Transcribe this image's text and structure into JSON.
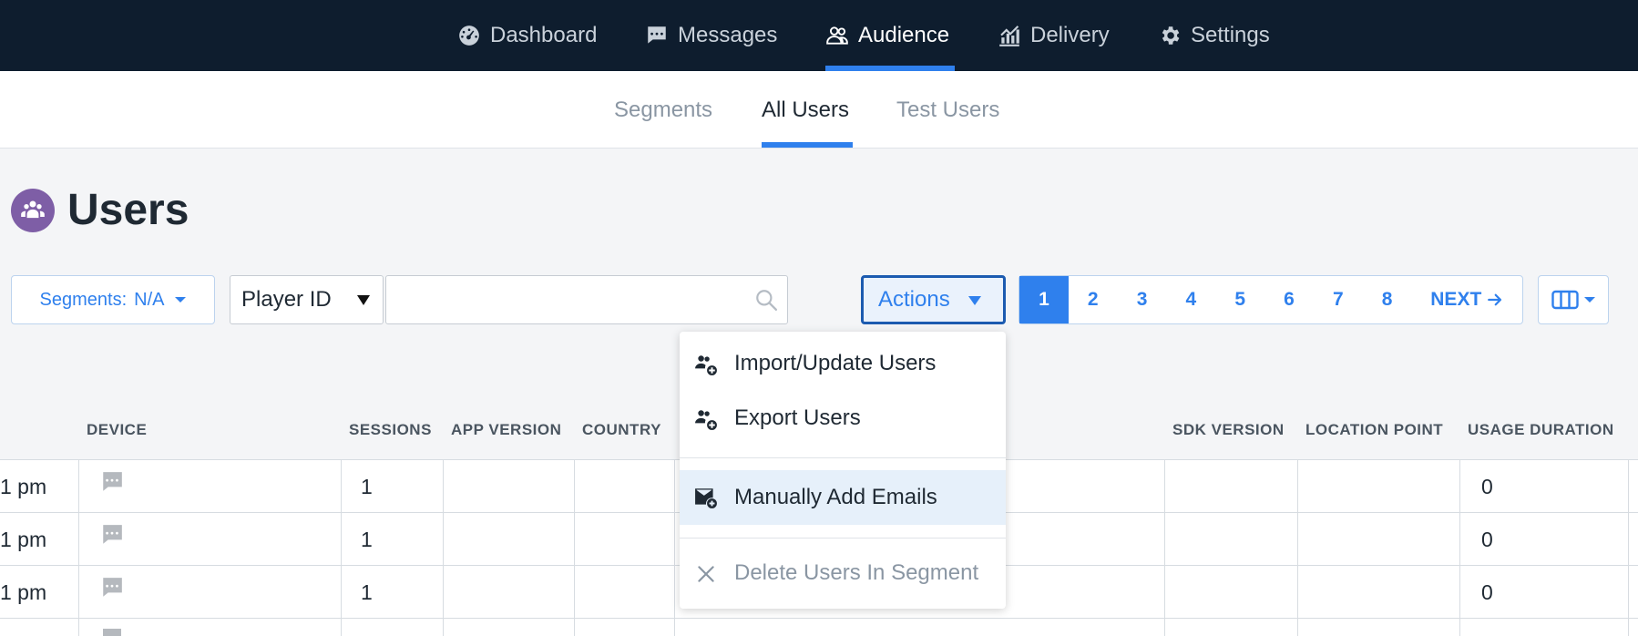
{
  "topnav": {
    "items": [
      {
        "label": "Dashboard",
        "icon": "dashboard-icon"
      },
      {
        "label": "Messages",
        "icon": "message-icon"
      },
      {
        "label": "Audience",
        "icon": "users-icon",
        "active": true
      },
      {
        "label": "Delivery",
        "icon": "chart-icon"
      },
      {
        "label": "Settings",
        "icon": "gear-icon"
      }
    ]
  },
  "subnav": {
    "items": [
      {
        "label": "Segments"
      },
      {
        "label": "All Users",
        "active": true
      },
      {
        "label": "Test Users"
      }
    ]
  },
  "page": {
    "title": "Users",
    "title_icon": "users-icon"
  },
  "filters": {
    "segments_label": "Segments:",
    "segments_value": "N/A",
    "field_select": "Player ID",
    "search_value": "",
    "search_placeholder": ""
  },
  "actions": {
    "label": "Actions"
  },
  "pager": {
    "pages": [
      "1",
      "2",
      "3",
      "4",
      "5",
      "6",
      "7",
      "8"
    ],
    "current": "1",
    "next_label": "NEXT"
  },
  "table": {
    "columns": [
      "DEVICE",
      "SESSIONS",
      "APP VERSION",
      "COUNTRY",
      "SDK VERSION",
      "LOCATION POINT",
      "USAGE DURATION"
    ],
    "rows": [
      {
        "time": "1 pm",
        "sessions": "1",
        "usage": "0"
      },
      {
        "time": "1 pm",
        "sessions": "1",
        "usage": "0"
      },
      {
        "time": "1 pm",
        "sessions": "1",
        "usage": "0"
      }
    ]
  },
  "actions_menu": {
    "items": [
      {
        "label": "Import/Update Users",
        "icon": "users-add-icon"
      },
      {
        "label": "Export Users",
        "icon": "users-add-icon"
      },
      {
        "label": "Manually Add Emails",
        "icon": "email-add-icon",
        "highlighted": true
      },
      {
        "label": "Delete Users In Segment",
        "icon": "close-icon",
        "disabled": true
      }
    ]
  },
  "colors": {
    "nav_bg": "#0e1d2e",
    "accent": "#2f80ed",
    "title_icon_bg": "#7e5ea6"
  }
}
